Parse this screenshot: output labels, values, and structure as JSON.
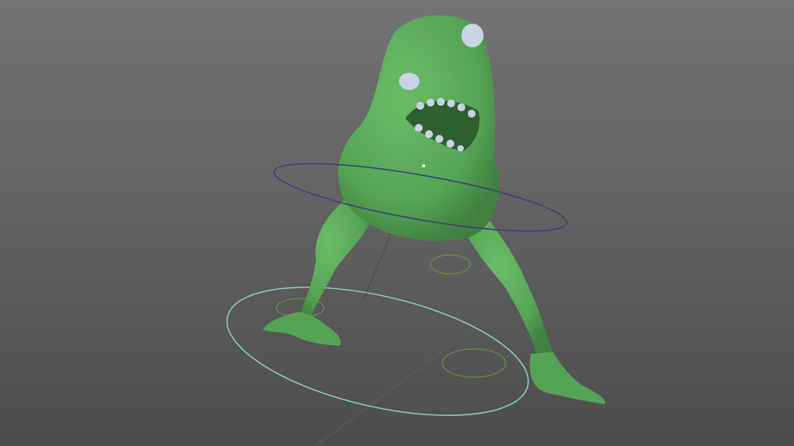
{
  "viewport": {
    "background_top": "#747474",
    "background_bottom": "#4c4c4c"
  },
  "character": {
    "skin_color": "#5aa85a",
    "skin_shadow": "#3f7f40",
    "eye_color": "#c9d3e3",
    "teeth_color": "#c9d3e3"
  },
  "rig": {
    "hip_control_color": "#3a3f78",
    "root_control_color": "#8ccfc4",
    "foot_control_color": "#6f9a3a"
  }
}
